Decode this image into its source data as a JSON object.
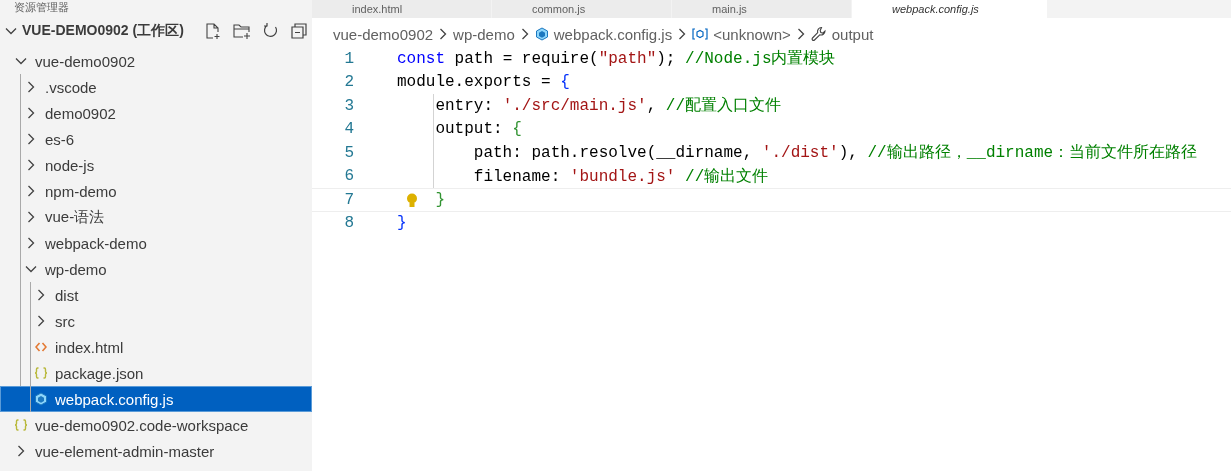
{
  "sidebar": {
    "title": "资源管理器",
    "workspace": {
      "label": "VUE-DEMO0902 (工作区)",
      "expanded": true
    },
    "tree": [
      {
        "label": "vue-demo0902",
        "kind": "folder",
        "expanded": true,
        "selected": false,
        "children": [
          {
            "label": ".vscode",
            "kind": "folder",
            "expanded": false,
            "selected": false
          },
          {
            "label": "demo0902",
            "kind": "folder",
            "expanded": false,
            "selected": false
          },
          {
            "label": "es-6",
            "kind": "folder",
            "expanded": false,
            "selected": false
          },
          {
            "label": "node-js",
            "kind": "folder",
            "expanded": false,
            "selected": false
          },
          {
            "label": "npm-demo",
            "kind": "folder",
            "expanded": false,
            "selected": false
          },
          {
            "label": "vue-语法",
            "kind": "folder",
            "expanded": false,
            "selected": false
          },
          {
            "label": "webpack-demo",
            "kind": "folder",
            "expanded": false,
            "selected": false
          },
          {
            "label": "wp-demo",
            "kind": "folder",
            "expanded": true,
            "selected": false,
            "children": [
              {
                "label": "dist",
                "kind": "folder",
                "expanded": false,
                "selected": false
              },
              {
                "label": "src",
                "kind": "folder",
                "expanded": false,
                "selected": false
              },
              {
                "label": "index.html",
                "kind": "html",
                "selected": false
              },
              {
                "label": "package.json",
                "kind": "json",
                "selected": false
              },
              {
                "label": "webpack.config.js",
                "kind": "webpack",
                "selected": true
              }
            ]
          }
        ]
      },
      {
        "label": "vue-demo0902.code-workspace",
        "kind": "json",
        "selected": false
      },
      {
        "label": "vue-element-admin-master",
        "kind": "folder",
        "expanded": false,
        "selected": false
      }
    ]
  },
  "tabs": [
    {
      "label": "index.html",
      "selected": false
    },
    {
      "label": "common.js",
      "selected": false
    },
    {
      "label": "main.js",
      "selected": false
    },
    {
      "label": "webpack.config.js",
      "selected": true
    }
  ],
  "breadcrumb": [
    {
      "label": "vue-demo0902",
      "kind": "text"
    },
    {
      "label": "wp-demo",
      "kind": "text"
    },
    {
      "label": "webpack.config.js",
      "kind": "webpack"
    },
    {
      "label": "<unknown>",
      "kind": "variable"
    },
    {
      "label": "output",
      "kind": "wrench"
    }
  ],
  "code": [
    {
      "number": "1",
      "current": false,
      "tokens": [
        {
          "t": "const",
          "kind": "keyword"
        },
        {
          "t": " path = require(",
          "kind": "plain"
        },
        {
          "t": "\"path\"",
          "kind": "string"
        },
        {
          "t": "); ",
          "kind": "plain"
        },
        {
          "t": "//Node.js内置模块",
          "kind": "comment"
        }
      ]
    },
    {
      "number": "2",
      "current": false,
      "tokens": [
        {
          "t": "module.exports = ",
          "kind": "plain"
        },
        {
          "t": "{",
          "kind": "bracket1"
        }
      ]
    },
    {
      "number": "3",
      "current": false,
      "tokens": [
        {
          "t": "    entry: ",
          "kind": "plain"
        },
        {
          "t": "'./src/main.js'",
          "kind": "string"
        },
        {
          "t": ", ",
          "kind": "plain"
        },
        {
          "t": "//配置入口文件",
          "kind": "comment"
        }
      ]
    },
    {
      "number": "4",
      "current": false,
      "tokens": [
        {
          "t": "    output: ",
          "kind": "plain"
        },
        {
          "t": "{",
          "kind": "bracket2"
        }
      ]
    },
    {
      "number": "5",
      "current": false,
      "tokens": [
        {
          "t": "        path: path.resolve(__dirname, ",
          "kind": "plain"
        },
        {
          "t": "'./dist'",
          "kind": "string"
        },
        {
          "t": "), ",
          "kind": "plain"
        },
        {
          "t": "//输出路径，__dirname：当前文件所在路径",
          "kind": "comment"
        }
      ]
    },
    {
      "number": "6",
      "current": false,
      "tokens": [
        {
          "t": "        filename: ",
          "kind": "plain"
        },
        {
          "t": "'bundle.js'",
          "kind": "string"
        },
        {
          "t": " //输出文件",
          "kind": "comment"
        }
      ]
    },
    {
      "number": "7",
      "current": true,
      "tokens": [
        {
          "t": "    }",
          "kind": "bracket2"
        }
      ]
    },
    {
      "number": "8",
      "current": false,
      "tokens": [
        {
          "t": "}",
          "kind": "bracket1"
        }
      ]
    }
  ]
}
